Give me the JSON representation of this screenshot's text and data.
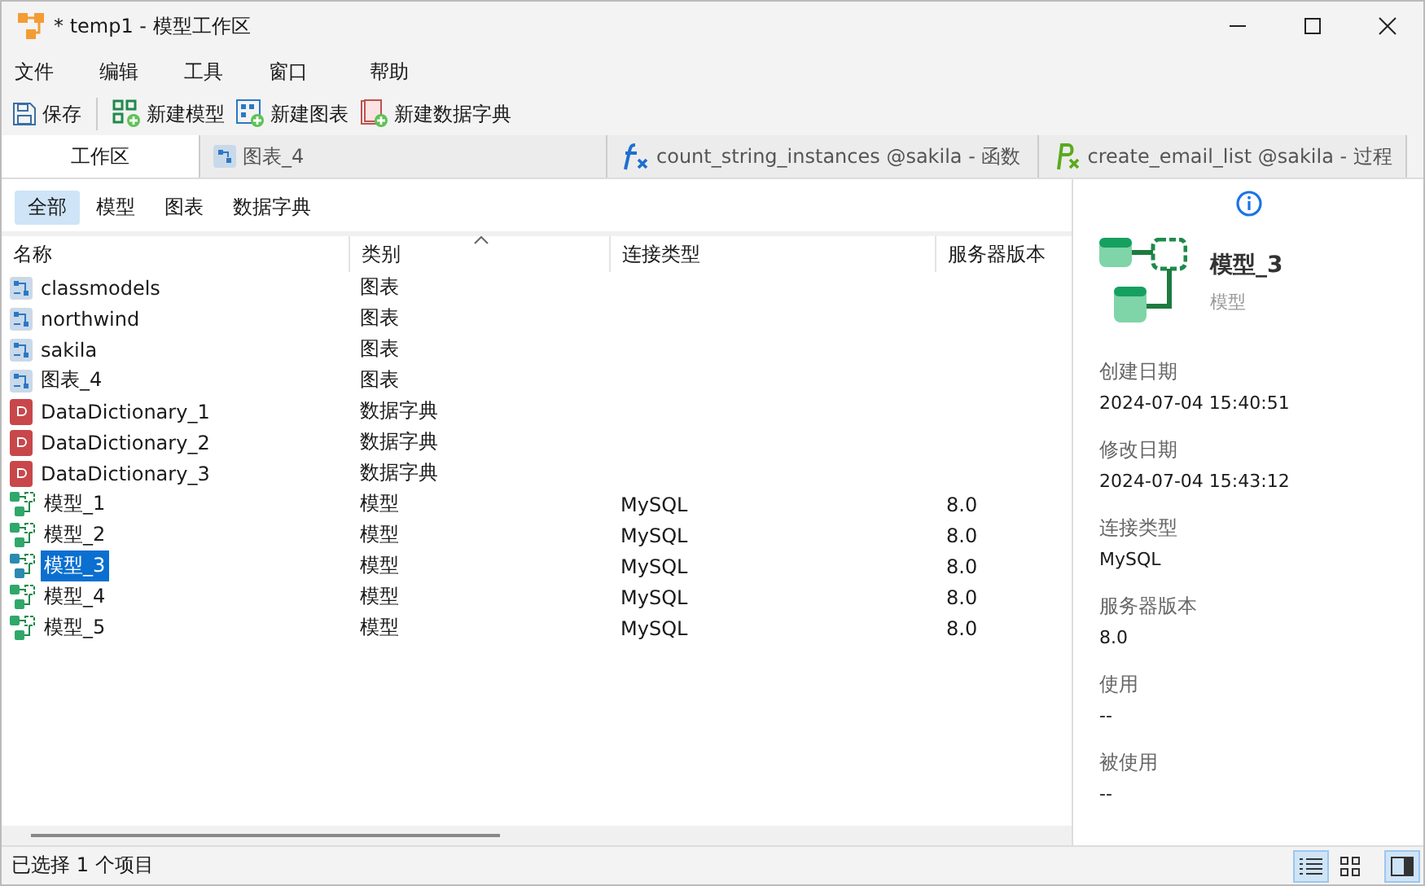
{
  "window": {
    "title": "* temp1 - 模型工作区"
  },
  "menu": [
    "文件",
    "编辑",
    "工具",
    "窗口",
    "帮助"
  ],
  "toolbar": [
    {
      "kind": "save",
      "label": "保存"
    },
    {
      "kind": "model",
      "label": "新建模型"
    },
    {
      "kind": "diagram",
      "label": "新建图表"
    },
    {
      "kind": "dictionary",
      "label": "新建数据字典"
    }
  ],
  "tabs": [
    {
      "kind": "workspace",
      "label": "工作区",
      "selected": true
    },
    {
      "kind": "diagram",
      "label": "图表_4",
      "selected": false
    },
    {
      "kind": "function",
      "label": "count_string_instances @sakila - 函数",
      "selected": false
    },
    {
      "kind": "procedure",
      "label": "create_email_list @sakila - 过程",
      "selected": false
    }
  ],
  "filters": [
    {
      "label": "全部",
      "selected": true
    },
    {
      "label": "模型",
      "selected": false
    },
    {
      "label": "图表",
      "selected": false
    },
    {
      "label": "数据字典",
      "selected": false
    }
  ],
  "table": {
    "columns": [
      "名称",
      "类别",
      "连接类型",
      "服务器版本"
    ],
    "rows": [
      {
        "kind": "diagram",
        "name": "classmodels",
        "type": "图表",
        "selected": false
      },
      {
        "kind": "diagram",
        "name": "northwind",
        "type": "图表",
        "selected": false
      },
      {
        "kind": "diagram",
        "name": "sakila",
        "type": "图表",
        "selected": false
      },
      {
        "kind": "diagram",
        "name": "图表_4",
        "type": "图表",
        "selected": false
      },
      {
        "kind": "dictionary",
        "name": "DataDictionary_1",
        "type": "数据字典",
        "selected": false
      },
      {
        "kind": "dictionary",
        "name": "DataDictionary_2",
        "type": "数据字典",
        "selected": false
      },
      {
        "kind": "dictionary",
        "name": "DataDictionary_3",
        "type": "数据字典",
        "selected": false
      },
      {
        "kind": "model",
        "name": "模型_1",
        "type": "模型",
        "connection": "MySQL",
        "version": "8.0",
        "selected": false
      },
      {
        "kind": "model",
        "name": "模型_2",
        "type": "模型",
        "connection": "MySQL",
        "version": "8.0",
        "selected": false
      },
      {
        "kind": "model",
        "name": "模型_3",
        "type": "模型",
        "connection": "MySQL",
        "version": "8.0",
        "selected": true
      },
      {
        "kind": "model",
        "name": "模型_4",
        "type": "模型",
        "connection": "MySQL",
        "version": "8.0",
        "selected": false
      },
      {
        "kind": "model",
        "name": "模型_5",
        "type": "模型",
        "connection": "MySQL",
        "version": "8.0",
        "selected": false
      }
    ]
  },
  "details": {
    "title": "模型_3",
    "subtitle": "模型",
    "fields": [
      {
        "label": "创建日期",
        "value": "2024-07-04 15:40:51"
      },
      {
        "label": "修改日期",
        "value": "2024-07-04 15:43:12"
      },
      {
        "label": "连接类型",
        "value": "MySQL"
      },
      {
        "label": "服务器版本",
        "value": "8.0"
      },
      {
        "label": "使用",
        "value": "--"
      },
      {
        "label": "被使用",
        "value": "--"
      }
    ]
  },
  "status_bar": {
    "text": "已选择 1 个项目",
    "views": [
      {
        "kind": "list",
        "selected": true
      },
      {
        "kind": "grid",
        "selected": false
      }
    ],
    "panel_shown": true
  }
}
